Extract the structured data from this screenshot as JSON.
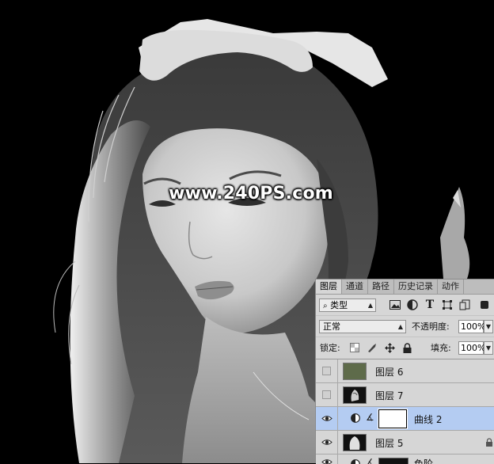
{
  "watermark": {
    "text": "www.240PS.com"
  },
  "panel": {
    "tabs": [
      {
        "label": "图层",
        "active": true
      },
      {
        "label": "通道",
        "active": false
      },
      {
        "label": "路径",
        "active": false
      },
      {
        "label": "历史记录",
        "active": false
      },
      {
        "label": "动作",
        "active": false
      }
    ],
    "filter": {
      "kind_label": "类型",
      "icons": [
        "image-filter-icon",
        "adjustment-filter-icon",
        "type-filter-icon",
        "shape-filter-icon",
        "smart-object-filter-icon"
      ]
    },
    "blend": {
      "mode": "正常",
      "opacity_label": "不透明度:",
      "opacity_value": "100%"
    },
    "lock": {
      "label": "锁定:",
      "icons": [
        "lock-transparent-icon",
        "lock-image-icon",
        "lock-position-icon",
        "lock-all-icon"
      ],
      "fill_label": "填充:",
      "fill_value": "100%"
    },
    "layers": [
      {
        "name": "图层 6",
        "visible": false,
        "selected": false,
        "thumb_color": "#5e6b4a",
        "type": "pixel"
      },
      {
        "name": "图层 7",
        "visible": false,
        "selected": false,
        "thumb_color": "#1a1a1a",
        "type": "pixel"
      },
      {
        "name": "曲线 2",
        "visible": true,
        "selected": true,
        "thumb_color": "#ffffff",
        "type": "adjustment"
      },
      {
        "name": "图层 5",
        "visible": true,
        "selected": false,
        "thumb_color": "#1a1a1a",
        "type": "pixel",
        "locked": true
      },
      {
        "name": "色阶",
        "visible": true,
        "selected": false,
        "thumb_color": "#1a1a1a",
        "type": "adjustment"
      }
    ]
  }
}
